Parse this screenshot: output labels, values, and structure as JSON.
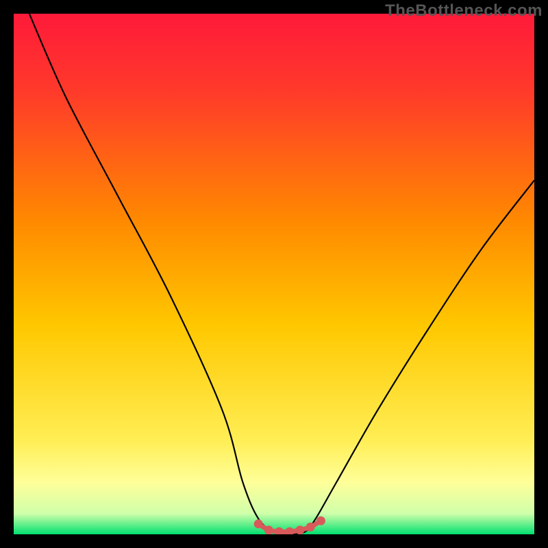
{
  "watermark": "TheBottleneck.com",
  "colors": {
    "frame": "#000000",
    "gradient_top": "#ff1a3a",
    "gradient_mid": "#ffc800",
    "gradient_low": "#ffff99",
    "gradient_bottom": "#00e070",
    "curve": "#000000",
    "marker": "#d85a5a"
  },
  "chart_data": {
    "type": "line",
    "title": "",
    "xlabel": "",
    "ylabel": "",
    "xlim": [
      0,
      100
    ],
    "ylim": [
      0,
      100
    ],
    "series": [
      {
        "name": "bottleneck-curve",
        "x": [
          3,
          10,
          20,
          30,
          40,
          44,
          47,
          50,
          53,
          56,
          58,
          62,
          70,
          80,
          90,
          100
        ],
        "y": [
          100,
          84,
          65,
          46,
          24,
          10,
          3,
          0.5,
          0,
          0.5,
          3,
          10,
          24,
          40,
          55,
          68
        ]
      }
    ],
    "markers": {
      "name": "highlight-dots",
      "x": [
        47,
        49,
        51,
        53,
        55,
        57,
        59
      ],
      "y": [
        2,
        0.8,
        0.5,
        0.5,
        0.8,
        1.4,
        2.6
      ]
    },
    "grid": false,
    "legend": false
  }
}
